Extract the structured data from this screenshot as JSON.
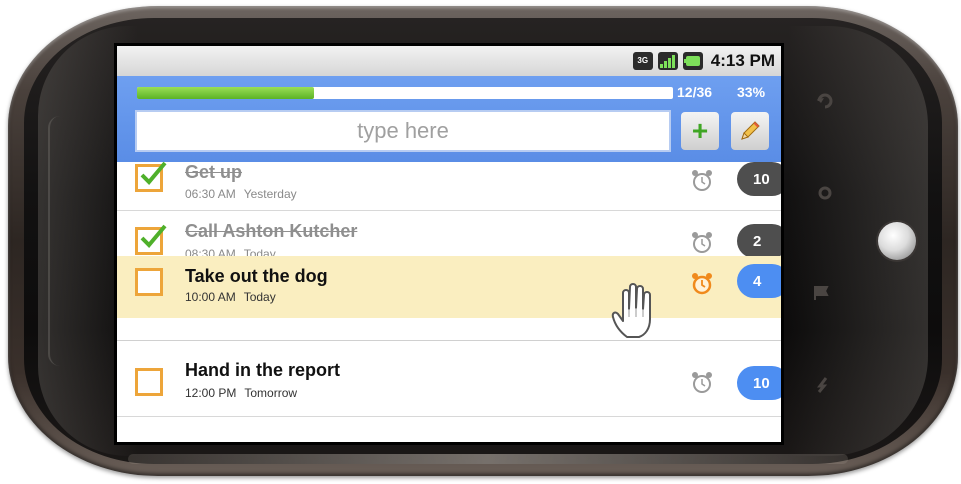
{
  "status_bar": {
    "network_label": "3G",
    "time": "4:13 PM"
  },
  "header": {
    "progress_count": "12/36",
    "progress_percent": "33%",
    "progress_fraction": 0.33,
    "input_placeholder": "type here",
    "add_icon": "plus-icon",
    "edit_icon": "pencil-icon"
  },
  "tasks": [
    {
      "title": "Get up",
      "time": "06:30 AM",
      "day": "Yesterday",
      "completed": true,
      "badge": "10",
      "badge_color": "#4e4e4e"
    },
    {
      "title": "Call Ashton Kutcher",
      "time": "08:30 AM",
      "day": "Today",
      "completed": true,
      "badge": "2",
      "badge_color": "#4e4e4e"
    },
    {
      "title": "Take out the dog",
      "time": "10:00 AM",
      "day": "Today",
      "completed": false,
      "badge": "4",
      "badge_color": "#4d8ef2",
      "highlighted": true,
      "alarm_active": true
    },
    {
      "title": "Hand in the report",
      "time": "12:00 PM",
      "day": "Tomorrow",
      "completed": false,
      "badge": "10",
      "badge_color": "#4d8ef2"
    }
  ],
  "colors": {
    "accent_blue": "#5a8de6",
    "progress_green": "#5cb325",
    "checkbox_orange": "#eda53a",
    "highlight_row": "#faeec0",
    "alarm_active": "#f08a1c"
  }
}
